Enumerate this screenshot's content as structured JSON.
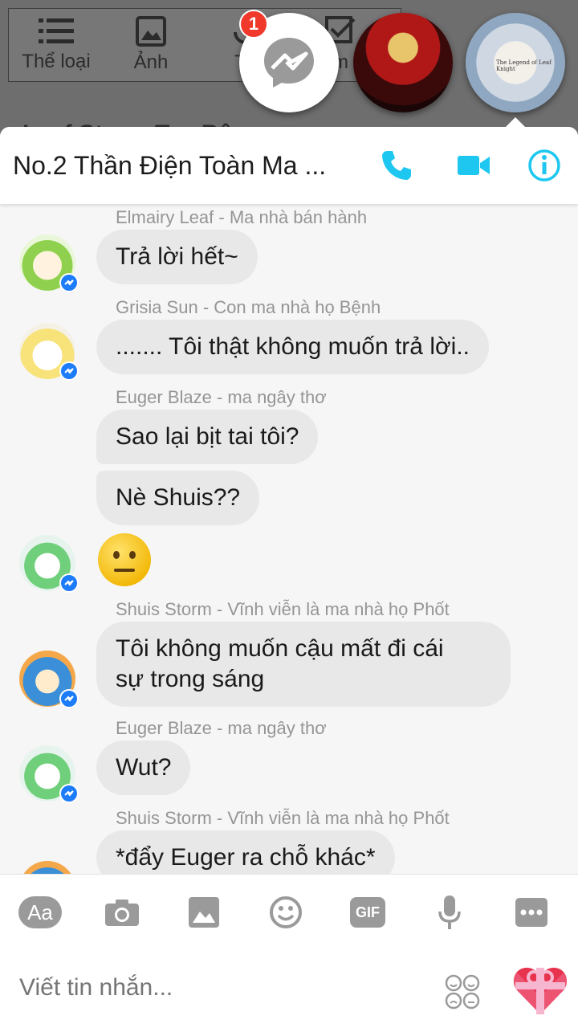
{
  "background_app": {
    "tools": [
      {
        "label": "Thể loại",
        "icon": "list-icon"
      },
      {
        "label": "Ảnh",
        "icon": "image-icon"
      },
      {
        "label": "Th",
        "icon": "vote-icon"
      },
      {
        "label": "m",
        "icon": "check-icon"
      }
    ],
    "title": "Leaf Storm Tea Bê"
  },
  "chat_heads": {
    "unread_badge": "1"
  },
  "art_head": {
    "caption": "The Legend of Leaf Knight"
  },
  "chat": {
    "title": "No.2 Thần Điện Toàn Ma ...",
    "accent_color": "#1dc7f0",
    "messages": [
      {
        "sender": "Elmairy Leaf - Ma nhà bán hành",
        "text": "Trả lời hết~"
      },
      {
        "sender": "Grisia Sun - Con ma nhà họ Bệnh",
        "text": "....... Tôi thật không muốn trả lời.."
      },
      {
        "sender": "Euger Blaze - ma ngây thơ",
        "text": "Sao lại bịt tai tôi?"
      },
      {
        "sender": "",
        "text": "Nè Shuis??"
      },
      {
        "sender": "Shuis Storm - Vĩnh viễn là ma nhà họ Phốt",
        "text": "Tôi không muốn cậu mất đi cái"
      },
      {
        "sender": "",
        "text": "sự trong sáng"
      },
      {
        "sender": "Euger Blaze - ma ngây thơ",
        "text": "Wut?"
      },
      {
        "sender": "Shuis Storm - Vĩnh viễn là ma nhà họ Phốt",
        "text": "*đẩy Euger ra chỗ khác*"
      }
    ]
  },
  "composer": {
    "aa_label": "Aa",
    "gif_label": "GIF",
    "placeholder": "Viết tin nhắn..."
  }
}
